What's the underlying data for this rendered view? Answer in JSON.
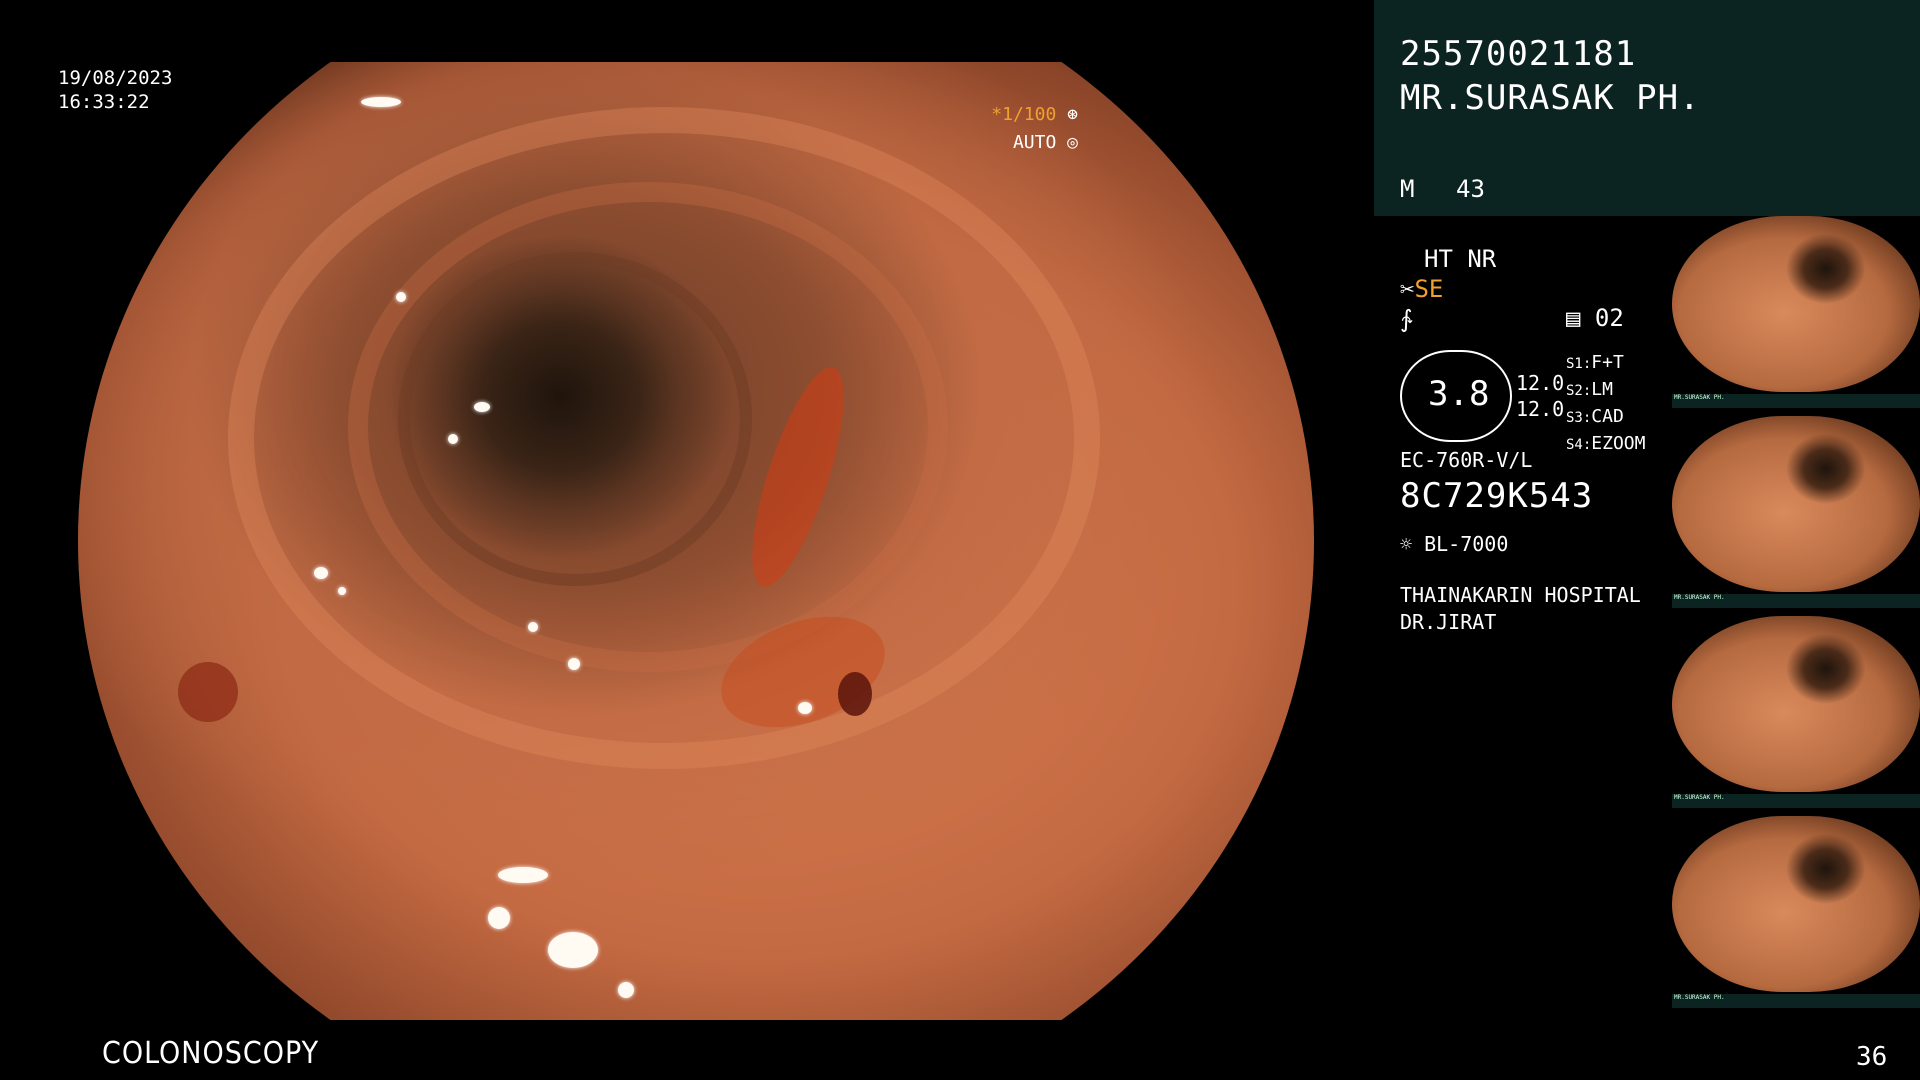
{
  "overlay": {
    "date": "19/08/2023",
    "time": "16:33:22",
    "shutter_speed": "1/100",
    "exposure_mode": "AUTO",
    "exam_type": "COLONOSCOPY",
    "image_count": "36"
  },
  "patient": {
    "id": "25570021181",
    "name": "MR.SURASAK PH.",
    "sex": "M",
    "age": "43"
  },
  "settings": {
    "line1": "HT NR",
    "line2": "SE",
    "mode_number": "02",
    "gauge_value": "3.8",
    "gauge_side_1": "12.0",
    "gauge_side_2": "12.0",
    "switches": [
      {
        "key": "S1:",
        "value": "F+T"
      },
      {
        "key": "S2:",
        "value": "LM"
      },
      {
        "key": "S3:",
        "value": "CAD"
      },
      {
        "key": "S4:",
        "value": "EZOOM"
      }
    ]
  },
  "scope": {
    "model": "EC-760R-V/L",
    "serial": "8C729K543",
    "light_source": "BL-7000"
  },
  "institution": {
    "hospital": "THAINAKARIN HOSPITAL",
    "doctor": "DR.JIRAT"
  },
  "thumbnails": [
    {
      "caption": "MR.SURASAK PH."
    },
    {
      "caption": "MR.SURASAK PH."
    },
    {
      "caption": "MR.SURASAK PH."
    },
    {
      "caption": "MR.SURASAK PH."
    }
  ],
  "colors": {
    "accent": "#f0a030",
    "panel": "#0b2321"
  },
  "icons": [
    "aperture-icon",
    "iris-icon",
    "scissors-icon",
    "signal-icon",
    "memory-icon",
    "lamp-icon"
  ]
}
